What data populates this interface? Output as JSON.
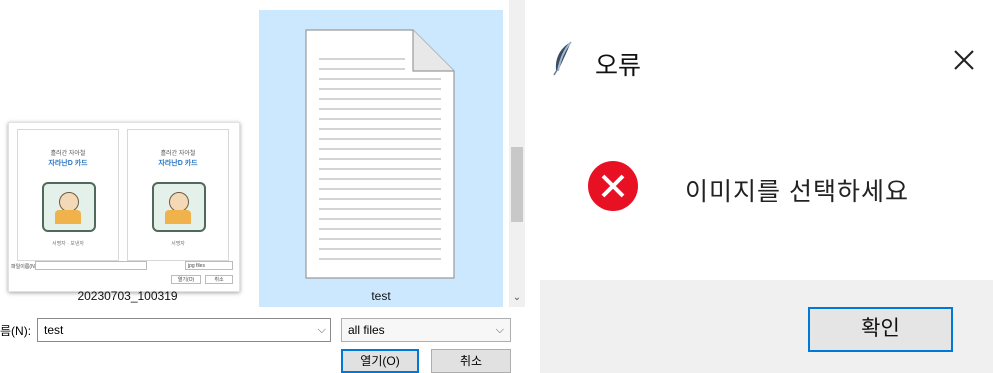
{
  "file_dialog": {
    "items": [
      {
        "name": "20230703_100319",
        "icon": "image-thumbnail-icon",
        "selected": false
      },
      {
        "name": "test",
        "icon": "blank-document-icon",
        "selected": true
      }
    ],
    "thumbnail": {
      "pages": [
        {
          "line1": "흘러간 자아철",
          "line2": "자라난D 카드",
          "caption": "서명자 · 보낸자"
        },
        {
          "line1": "흘러간 자아철",
          "line2": "자라난D 카드",
          "caption": "서명자"
        }
      ],
      "mini_filename_label": "파일이름(N):",
      "mini_type": "jpg files",
      "mini_open": "열기(O)",
      "mini_cancel": "취소"
    },
    "filename_label": "름(N):",
    "filename_value": "test",
    "file_type": "all files",
    "open_label": "열기(O)",
    "cancel_label": "취소"
  },
  "error_dialog": {
    "title": "오류",
    "message": "이미지를 선택하세요",
    "ok_label": "확인",
    "colors": {
      "error_red": "#e81123",
      "accent_blue": "#0078d7"
    }
  }
}
